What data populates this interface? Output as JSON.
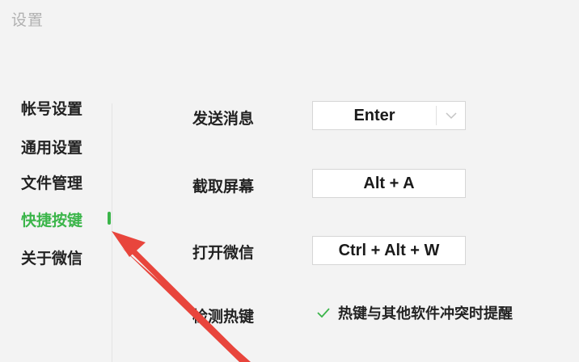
{
  "window": {
    "title": "设置"
  },
  "sidebar": {
    "items": [
      {
        "label": "帐号设置",
        "active": false
      },
      {
        "label": "通用设置",
        "active": false
      },
      {
        "label": "文件管理",
        "active": false
      },
      {
        "label": "快捷按键",
        "active": true
      },
      {
        "label": "关于微信",
        "active": false
      }
    ]
  },
  "shortcuts": {
    "send_message": {
      "label": "发送消息",
      "value": "Enter"
    },
    "screenshot": {
      "label": "截取屏幕",
      "value": "Alt + A"
    },
    "open_wechat": {
      "label": "打开微信",
      "value": "Ctrl + Alt + W"
    },
    "detect_hotkey": {
      "label": "检测热键",
      "checkbox_label": "热键与其他软件冲突时提醒",
      "checked": true
    }
  },
  "colors": {
    "accent": "#3bb54a",
    "annotation_arrow": "#e8453c"
  },
  "icons": {
    "dropdown": "chevron-down-icon",
    "checkbox": "checkmark-icon",
    "annotation": "red-arrow-annotation"
  }
}
